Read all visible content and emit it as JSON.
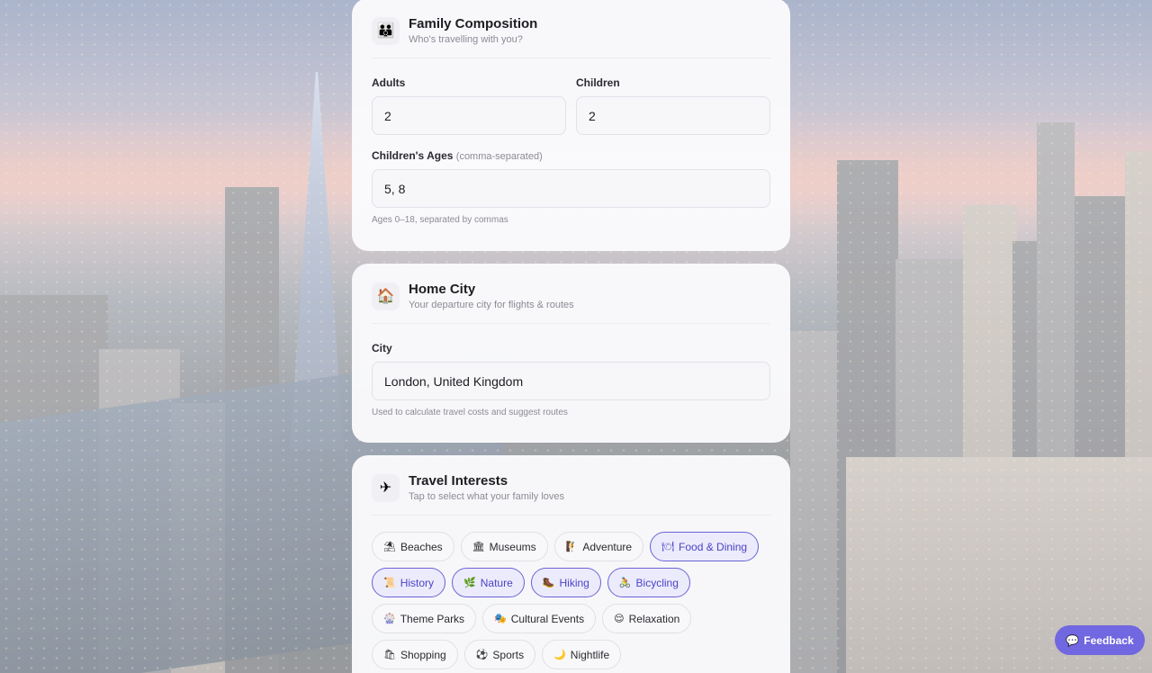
{
  "family": {
    "title": "Family Composition",
    "subtitle": "Who's travelling with you?",
    "icon": "family-icon",
    "adults_label": "Adults",
    "adults_value": "2",
    "children_label": "Children",
    "children_value": "2",
    "ages_label": "Children's Ages",
    "ages_label_note": "(comma-separated)",
    "ages_value": "5, 8",
    "ages_hint": "Ages 0–18, separated by commas"
  },
  "home": {
    "title": "Home City",
    "subtitle": "Your departure city for flights & routes",
    "icon": "house-icon",
    "city_label": "City",
    "city_value": "London, United Kingdom",
    "city_hint": "Used to calculate travel costs and suggest routes"
  },
  "interests": {
    "title": "Travel Interests",
    "subtitle": "Tap to select what your family loves",
    "icon": "airplane-icon",
    "chips": [
      {
        "emoji": "⛱",
        "label": "Beaches",
        "selected": false
      },
      {
        "emoji": "🏛",
        "label": "Museums",
        "selected": false
      },
      {
        "emoji": "🧗",
        "label": "Adventure",
        "selected": false
      },
      {
        "emoji": "🍽",
        "label": "Food & Dining",
        "selected": true
      },
      {
        "emoji": "📜",
        "label": "History",
        "selected": true
      },
      {
        "emoji": "🌿",
        "label": "Nature",
        "selected": true
      },
      {
        "emoji": "🥾",
        "label": "Hiking",
        "selected": true
      },
      {
        "emoji": "🚴",
        "label": "Bicycling",
        "selected": true
      },
      {
        "emoji": "🎡",
        "label": "Theme Parks",
        "selected": false
      },
      {
        "emoji": "🎭",
        "label": "Cultural Events",
        "selected": false
      },
      {
        "emoji": "😌",
        "label": "Relaxation",
        "selected": false
      },
      {
        "emoji": "🛍",
        "label": "Shopping",
        "selected": false
      },
      {
        "emoji": "⚽",
        "label": "Sports",
        "selected": false
      },
      {
        "emoji": "🌙",
        "label": "Nightlife",
        "selected": false
      }
    ]
  },
  "feedback": {
    "emoji": "💬",
    "label": "Feedback"
  },
  "colors": {
    "accent": "#7167e0",
    "selected_border": "#6a63d8",
    "selected_bg": "#ecebfb"
  }
}
